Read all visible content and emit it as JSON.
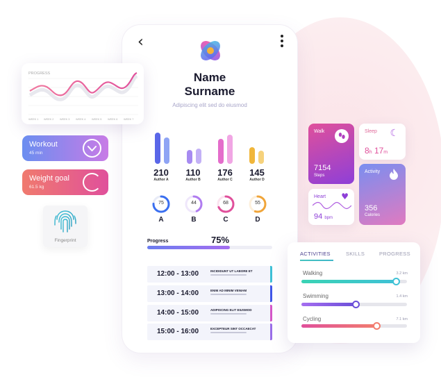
{
  "profile": {
    "name_first": "Name",
    "name_last": "Surname",
    "subtitle": "Adipiscing elit sed do eiusmod"
  },
  "stats": [
    {
      "value": "210",
      "label": "Author A",
      "colors": [
        "#5a67e8",
        "#8fa4f4"
      ]
    },
    {
      "value": "110",
      "label": "Author B",
      "colors": [
        "#a78bf1",
        "#c3b1f6"
      ]
    },
    {
      "value": "176",
      "label": "Author C",
      "colors": [
        "#e46dcb",
        "#f1a6e4"
      ]
    },
    {
      "value": "145",
      "label": "Author D",
      "colors": [
        "#f0b63a",
        "#f6d27c"
      ]
    }
  ],
  "rings": [
    {
      "value": "75",
      "letter": "A",
      "color": "#3a6ff0"
    },
    {
      "value": "44",
      "letter": "B",
      "color": "#b07cf0"
    },
    {
      "value": "68",
      "letter": "C",
      "color": "#e0509b"
    },
    {
      "value": "55",
      "letter": "D",
      "color": "#f0a53a"
    }
  ],
  "progress": {
    "label": "Progress",
    "value": "75%",
    "fraction": 0.66
  },
  "schedule": [
    {
      "time": "12:00 - 13:00",
      "title": "INCIDIDUNT UT LABORE ET",
      "color": "#3fc1d6"
    },
    {
      "time": "13:00 - 14:00",
      "title": "ENIM AD MINIM VENIAM",
      "color": "#4057e8"
    },
    {
      "time": "14:00 - 15:00",
      "title": "ADIPISCING ELIT EIUSMOD",
      "color": "#d457c8"
    },
    {
      "time": "15:00 - 16:00",
      "title": "EXCEPTEUR SINT OCCAECAT",
      "color": "#9a6ee8"
    }
  ],
  "chart_card": {
    "title": "PROGRESS",
    "weeks": [
      "WEEK 1",
      "WEEK 2",
      "WEEK 3",
      "WEEK 4",
      "WEEK 5",
      "WEEK 6",
      "WEEK 7"
    ]
  },
  "workout": {
    "title": "Workout",
    "sub": "45 min"
  },
  "weight": {
    "title": "Weight goal",
    "sub": "61.5 kg"
  },
  "fingerprint": {
    "label": "Fingerprint"
  },
  "tiles": {
    "walk": {
      "title": "Walk",
      "value": "7154",
      "unit": "Steps"
    },
    "sleep": {
      "title": "Sleep",
      "h": "8",
      "h_unit": "h",
      "m": "17",
      "m_unit": "m"
    },
    "heart": {
      "title": "Heart",
      "value": "94",
      "unit": "bpm"
    },
    "activity": {
      "title": "Activity",
      "value": "356",
      "unit": "Calories"
    }
  },
  "activities": {
    "tabs": [
      "ACTIVITIES",
      "SKILLS",
      "PROGRESS"
    ],
    "items": [
      {
        "label": "Walking",
        "km": "3.2 km",
        "fraction": 0.9,
        "color": "linear-gradient(90deg,#3ad3b4,#3fc1d6)",
        "knob": "#3fc1d6"
      },
      {
        "label": "Swimming",
        "km": "1.4 km",
        "fraction": 0.52,
        "color": "linear-gradient(90deg,#a56ef0,#6b4fd8)",
        "knob": "#6b4fd8"
      },
      {
        "label": "Cycling",
        "km": "7.1 km",
        "fraction": 0.72,
        "color": "linear-gradient(90deg,#e0509b,#f27d6e)",
        "knob": "#f27d6e"
      }
    ]
  }
}
